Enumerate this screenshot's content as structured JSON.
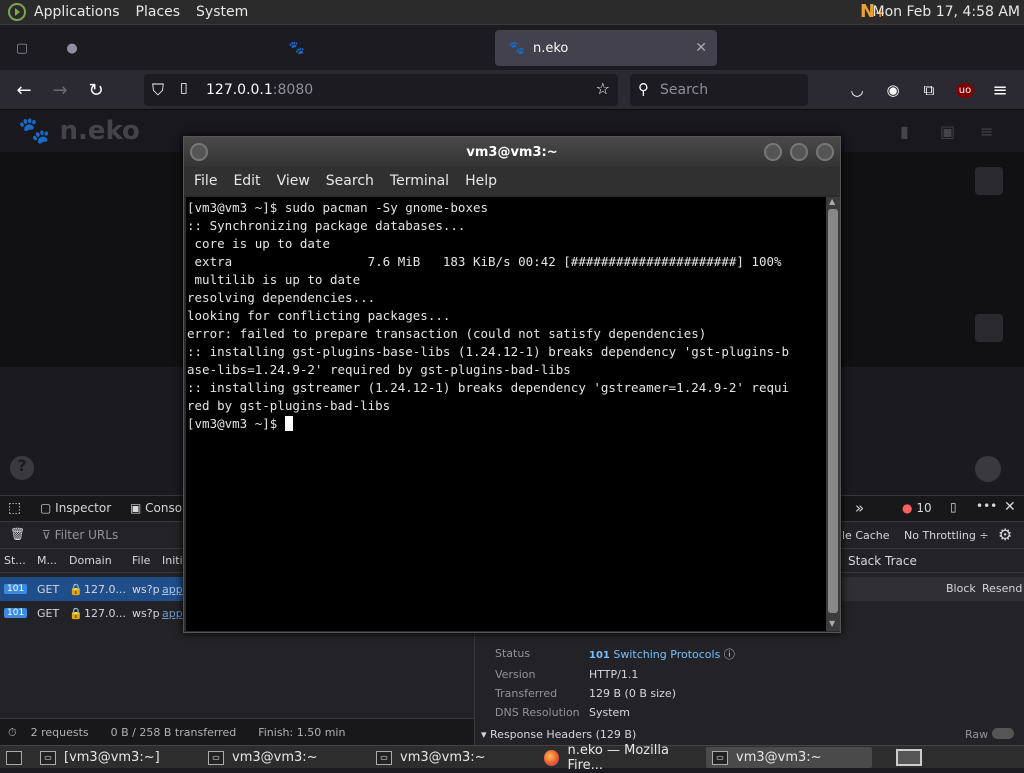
{
  "panel": {
    "menus": [
      "Applications",
      "Places",
      "System"
    ],
    "clock": "Mon Feb 17,  4:58 AM"
  },
  "firefox": {
    "active_tab": "n.eko",
    "url_host": "127.0.0.1",
    "url_port": ":8080",
    "search_placeholder": "Search"
  },
  "neko": {
    "logo": "n.eko"
  },
  "devtools": {
    "tabs": [
      "Inspector",
      "Console"
    ],
    "error_count": "10",
    "filter_placeholder": "Filter URLs",
    "cache_label": "le Cache",
    "throttling": "No Throttling ÷",
    "columns": [
      "St...",
      "M...",
      "Domain",
      "File",
      "Initi"
    ],
    "rows": [
      {
        "status": "101",
        "method": "GET",
        "domain": "127.0...",
        "file": "ws?p",
        "init": "app."
      },
      {
        "status": "101",
        "method": "GET",
        "domain": "127.0...",
        "file": "ws?p",
        "init": "app."
      }
    ],
    "stack_trace": "Stack Trace",
    "block": "Block",
    "resend": "Resend",
    "details": {
      "status_label": "Status",
      "status_code": "101",
      "status_text": "Switching Protocols",
      "version_label": "Version",
      "version": "HTTP/1.1",
      "transferred_label": "Transferred",
      "transferred": "129 B (0 B size)",
      "dns_label": "DNS Resolution",
      "dns": "System",
      "response_headers": "Response Headers (129 B)",
      "raw": "Raw"
    },
    "summary": {
      "requests": "2 requests",
      "transferred": "0 B / 258 B transferred",
      "finish": "Finish: 1.50 min"
    }
  },
  "terminal": {
    "title": "vm3@vm3:~",
    "menu": [
      "File",
      "Edit",
      "View",
      "Search",
      "Terminal",
      "Help"
    ],
    "lines": [
      "[vm3@vm3 ~]$ sudo pacman -Sy gnome-boxes",
      ":: Synchronizing package databases...",
      " core is up to date",
      " extra                  7.6 MiB   183 KiB/s 00:42 [######################] 100%",
      " multilib is up to date",
      "resolving dependencies...",
      "looking for conflicting packages...",
      "error: failed to prepare transaction (could not satisfy dependencies)",
      ":: installing gst-plugins-base-libs (1.24.12-1) breaks dependency 'gst-plugins-b",
      "ase-libs=1.24.9-2' required by gst-plugins-bad-libs",
      ":: installing gstreamer (1.24.12-1) breaks dependency 'gstreamer=1.24.9-2' requi",
      "red by gst-plugins-bad-libs"
    ],
    "prompt": "[vm3@vm3 ~]$ "
  },
  "taskbar": {
    "items": [
      "[vm3@vm3:~]",
      "vm3@vm3:~",
      "vm3@vm3:~",
      "n.eko — Mozilla Fire...",
      "vm3@vm3:~"
    ]
  }
}
